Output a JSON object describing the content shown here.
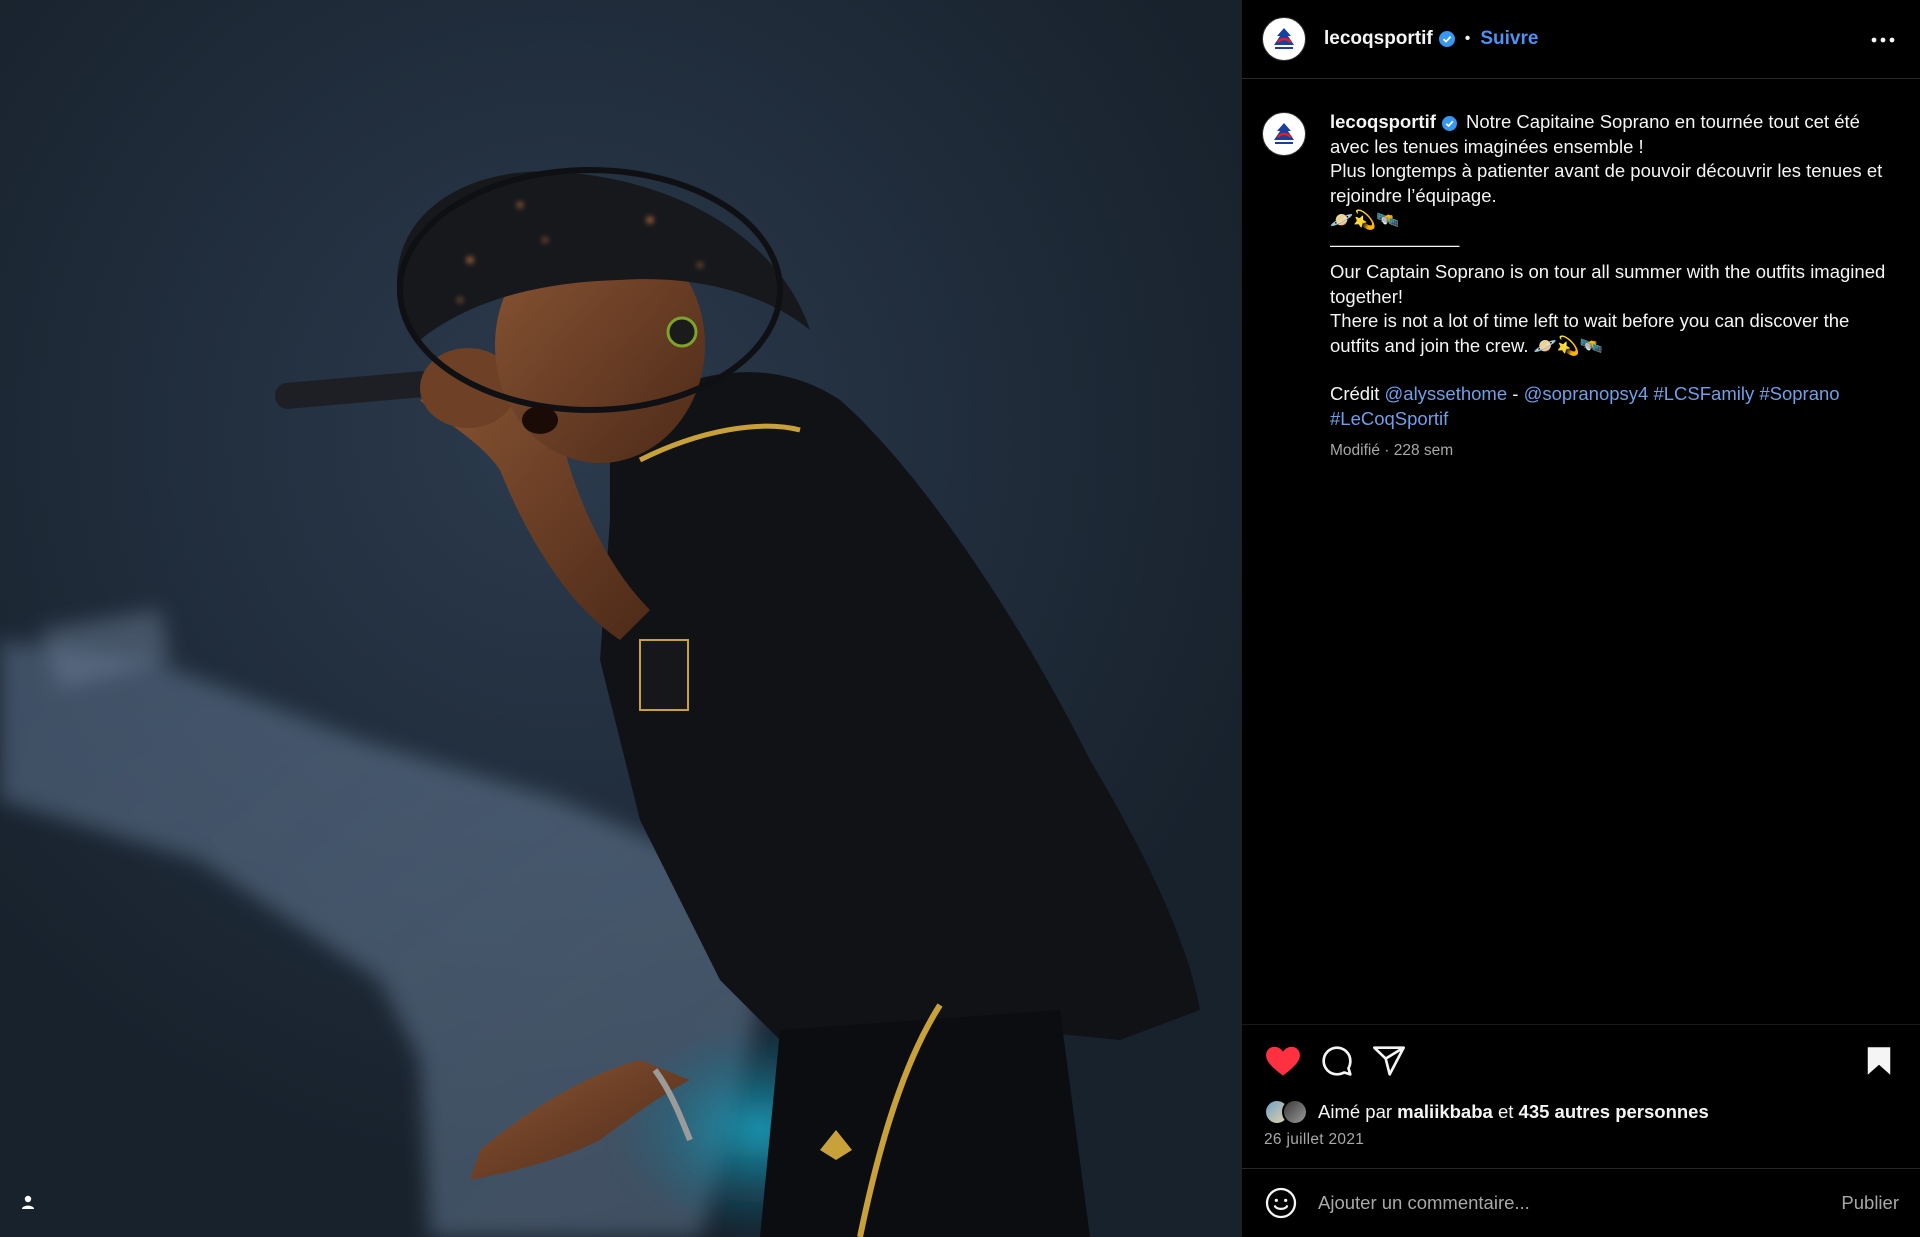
{
  "post": {
    "username": "lecoqsportif",
    "follow_label": "Suivre",
    "dot": "•",
    "caption": {
      "line1": "Notre Capitaine Soprano en tournée tout cet été avec les tenues imaginées ensemble !",
      "line2": "Plus longtemps à patienter avant de pouvoir découvrir les tenues et rejoindre l’équipage.",
      "emoji_line": "🪐💫🛰️",
      "divider": "———————",
      "en_line1": "Our Captain Soprano is on tour all summer with the outfits imagined together!",
      "en_line2": "There is not a lot of time left to wait before you can discover the outfits and join the crew.",
      "en_emojis": "🪐💫🛰️",
      "credit_label": "Crédit",
      "credit_mention1": "@alyssethome",
      "credit_dash": "-",
      "credit_mention2": "@sopranopsy4",
      "tag1": "#LCSFamily",
      "tag2": "#Soprano",
      "tag3": "#LeCoqSportif"
    },
    "modified": "Modifié · 228 sem",
    "likes": {
      "prefix": "Aimé par",
      "user": "maliikbaba",
      "middle": "et",
      "others": "435 autres personnes"
    },
    "date": "26 juillet 2021"
  },
  "comment": {
    "placeholder": "Ajouter un commentaire...",
    "publish_label": "Publier"
  },
  "icons": {
    "verified": "verified-badge-icon",
    "more": "more-options-icon",
    "like": "heart-icon",
    "comment": "comment-icon",
    "share": "share-icon",
    "save": "bookmark-icon",
    "emoji": "emoji-icon",
    "user_tag": "user-tag-icon"
  },
  "colors": {
    "accent": "#4f90f2",
    "link": "#6f9fe8",
    "like_red": "#ff3040",
    "muted": "#a8a8a8"
  }
}
